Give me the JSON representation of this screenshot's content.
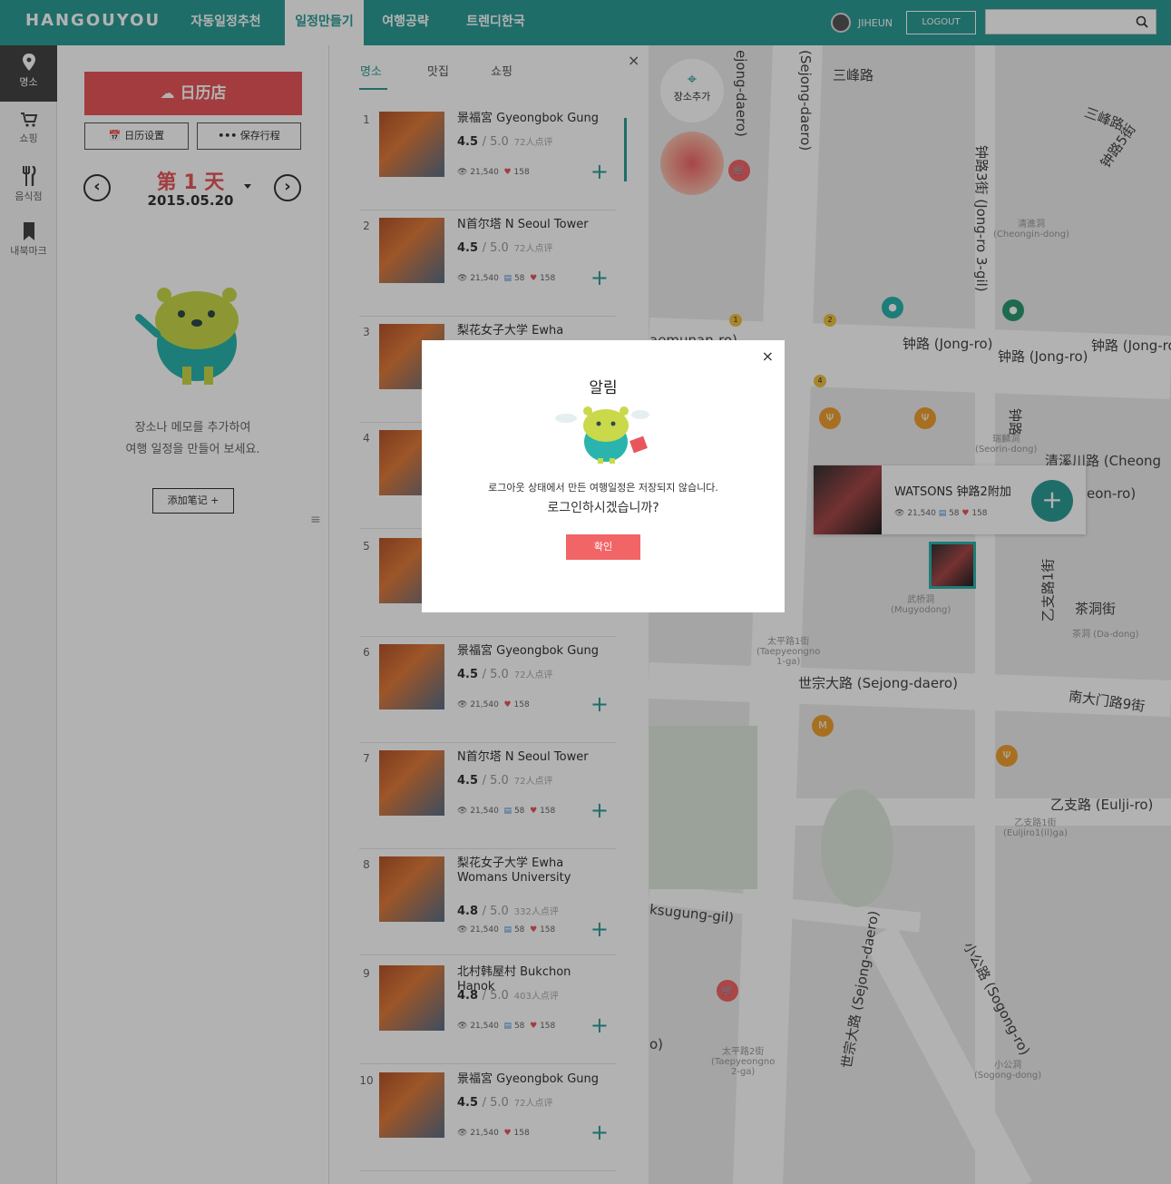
{
  "header": {
    "logo": "HANGOUYOU",
    "nav": [
      "자동일정추천",
      "일정만들기",
      "여행공략",
      "트렌디한국"
    ],
    "user": "JIHEUN",
    "logout": "LOGOUT",
    "search_placeholder": ""
  },
  "sidebar": {
    "items": [
      "명소",
      "쇼핑",
      "음식점",
      "내북마크"
    ]
  },
  "panel": {
    "calendar_button": "日历店",
    "settings_button": "日历设置",
    "save_button": "保存行程",
    "day": "第 1 天",
    "date": "2015.05.20",
    "hint_line1": "장소나 메모를 추가하여",
    "hint_line2": "여행 일정을 만들어 보세요.",
    "add_note": "添加笔记 +"
  },
  "list": {
    "tabs": [
      "명소",
      "맛집",
      "쇼핑"
    ],
    "close": "×",
    "items": [
      {
        "num": "1",
        "title": "景福宮 Gyeongbok Gung",
        "rating": "4.5",
        "out_of": "/ 5.0",
        "reviews": "72人点评",
        "views": "21,540",
        "comments": "",
        "likes": "158"
      },
      {
        "num": "2",
        "title": "N首尔塔  N Seoul Tower",
        "rating": "4.5",
        "out_of": "/ 5.0",
        "reviews": "72人点评",
        "views": "21,540",
        "comments": "58",
        "likes": "158"
      },
      {
        "num": "3",
        "title": "梨花女子大学  Ewha",
        "rating": "",
        "out_of": "",
        "reviews": "",
        "views": "",
        "comments": "",
        "likes": ""
      },
      {
        "num": "4",
        "title": "",
        "rating": "",
        "out_of": "",
        "reviews": "",
        "views": "",
        "comments": "",
        "likes": ""
      },
      {
        "num": "5",
        "title": "",
        "rating": "",
        "out_of": "",
        "reviews": "",
        "views": "",
        "comments": "",
        "likes": ""
      },
      {
        "num": "6",
        "title": "景福宮 Gyeongbok Gung",
        "rating": "4.5",
        "out_of": "/ 5.0",
        "reviews": "72人点评",
        "views": "21,540",
        "comments": "",
        "likes": "158"
      },
      {
        "num": "7",
        "title": "N首尔塔  N Seoul Tower",
        "rating": "4.5",
        "out_of": "/ 5.0",
        "reviews": "72人点评",
        "views": "21,540",
        "comments": "58",
        "likes": "158"
      },
      {
        "num": "8",
        "title": "梨花女子大学  Ewha Womans University",
        "rating": "4.8",
        "out_of": "/ 5.0",
        "reviews": "332人点评",
        "views": "21,540",
        "comments": "58",
        "likes": "158"
      },
      {
        "num": "9",
        "title": "北村韩屋村 Bukchon Hanok",
        "rating": "4.8",
        "out_of": "/ 5.0",
        "reviews": "403人点评",
        "views": "21,540",
        "comments": "58",
        "likes": "158"
      },
      {
        "num": "10",
        "title": "景福宮 Gyeongbok Gung",
        "rating": "4.5",
        "out_of": "/ 5.0",
        "reviews": "72人点评",
        "views": "21,540",
        "comments": "",
        "likes": "158"
      }
    ]
  },
  "map": {
    "add_place": "장소추가",
    "labels": [
      "三峰路",
      "(Sejong-daero)",
      "ejong-daero)",
      "三峰路",
      "钟路5街",
      "钟路3街 (Jong-ro 3-gil)",
      "钟路 (Jong-ro)",
      "钟路 (Jong-ro)",
      "钟路 (Jong-ro",
      "清溪川路 (Cheong",
      "eon-ro)",
      "世宗大路 (Sejong-daero)",
      "南大门路9街",
      "乙支路 (Eulji-ro)",
      "世宗大路 (Sejong-daero)",
      "小公路 (Sogong-ro)",
      "乙支路1街",
      "茶洞街",
      "ksugung-gil)",
      "aemunan-ro)",
      "o)",
      "钟路"
    ],
    "small": [
      "清進洞\n(Cheongin-dong)",
      "瑞麟洞\n(Seorin-dong)",
      "武桥洞\n(Mugyodong)",
      "太平路1街\n(Taepyeongno\n1-ga)",
      "茶洞 (Da-dong)",
      "乙支路1街\n(Euljiro1(il)ga)",
      "太平路2街\n(Taepyeongno\n2-ga)",
      "小公洞\n(Sogong-dong)"
    ],
    "pins": [
      "1",
      "2",
      "4"
    ],
    "card": {
      "title": "WATSONS 钟路2附加",
      "views": "21,540",
      "comments": "58",
      "likes": "158"
    }
  },
  "modal": {
    "title": "알림",
    "message": "로그아웃 상태에서 만든 여행일정은 저장되지 않습니다.",
    "question": "로그인하시겠습니까?",
    "confirm": "확인",
    "close": "×"
  }
}
